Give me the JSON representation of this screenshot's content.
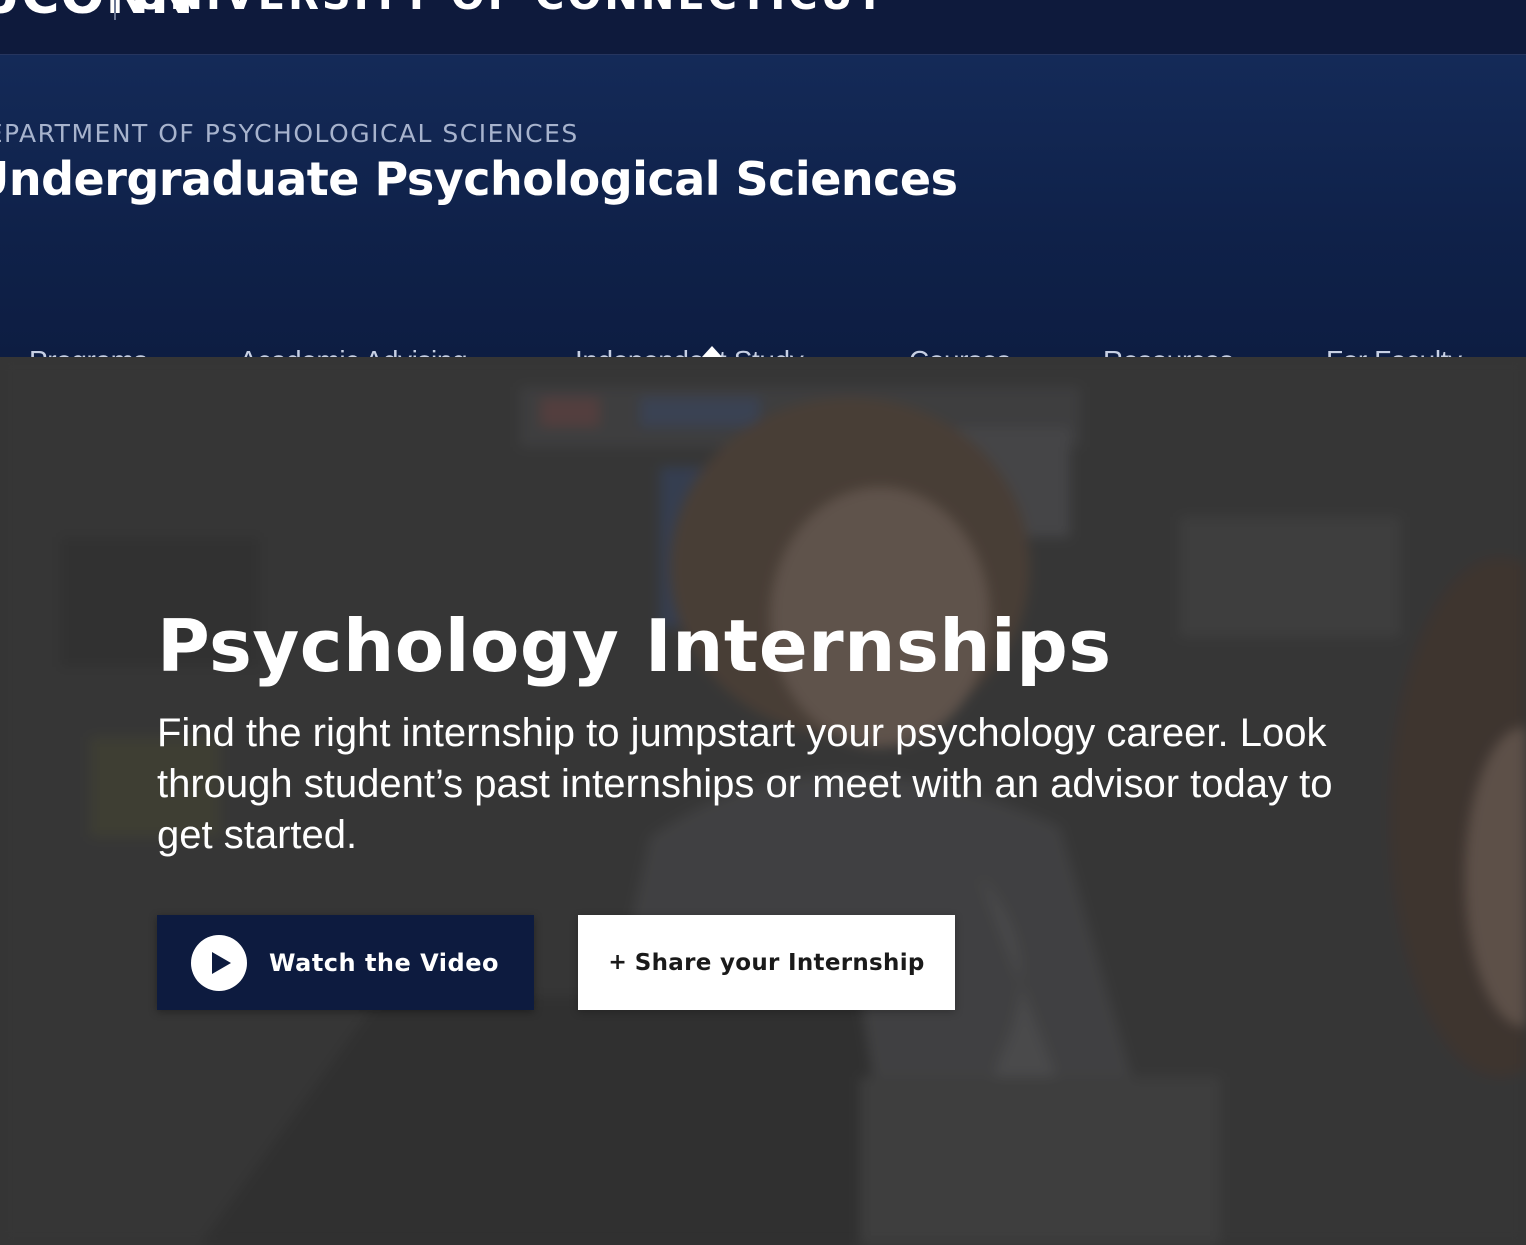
{
  "university_bar": {
    "wordmark": "UCONN",
    "name": "UNIVERSITY OF CONNECTICUT"
  },
  "header": {
    "department": "DEPARTMENT OF PSYCHOLOGICAL SCIENCES",
    "site_title": "Undergraduate Psychological Sciences"
  },
  "nav": {
    "items": [
      {
        "label": "Programs",
        "icon": "caret-down-icon"
      },
      {
        "label": "Academic Advising",
        "icon": "caret-down-icon"
      },
      {
        "label": "Independent Study",
        "icon": "caret-down-icon",
        "active": true
      },
      {
        "label": "Courses",
        "icon": "caret-down-icon"
      },
      {
        "label": "Resources",
        "icon": "caret-down-icon"
      },
      {
        "label": "For Faculty",
        "icon": "caret-down-icon"
      }
    ]
  },
  "hero": {
    "title": "Psychology Internships",
    "text": "Find the right internship to jumpstart your psychology career. Look through student’s past internships or meet with an advisor today to get started.",
    "video_button": {
      "label": "Watch the Video",
      "icon": "play-icon"
    },
    "share_button": {
      "plus": "+",
      "label": "Share your Internship",
      "icon": "plus-icon"
    }
  },
  "colors": {
    "brand_navy": "#0e1a3c",
    "header_blue": "#13275a",
    "nav_text": "#c7d0e4",
    "button_dark": "#0d1b3f",
    "button_light": "#ffffff"
  }
}
